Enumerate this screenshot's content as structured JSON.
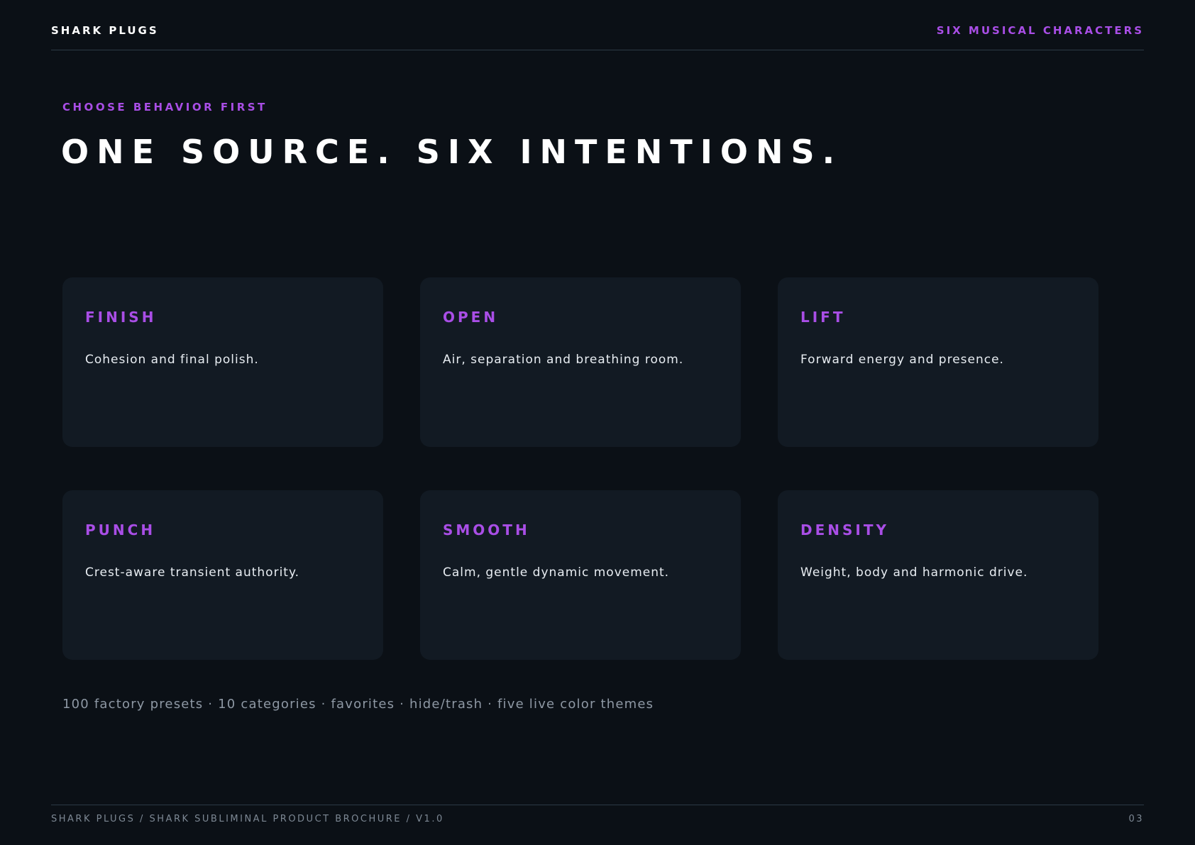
{
  "header": {
    "brand": "SHARK PLUGS",
    "tag": "SIX MUSICAL CHARACTERS"
  },
  "hero": {
    "eyebrow": "CHOOSE BEHAVIOR FIRST",
    "headline": "ONE SOURCE. SIX INTENTIONS."
  },
  "cards": [
    {
      "title": "FINISH",
      "description": "Cohesion and final polish."
    },
    {
      "title": "OPEN",
      "description": "Air, separation and breathing room."
    },
    {
      "title": "LIFT",
      "description": "Forward energy and presence."
    },
    {
      "title": "PUNCH",
      "description": "Crest-aware transient authority."
    },
    {
      "title": "SMOOTH",
      "description": "Calm, gentle dynamic movement."
    },
    {
      "title": "DENSITY",
      "description": "Weight, body and harmonic drive."
    }
  ],
  "summary": "100 factory presets · 10 categories · favorites · hide/trash · five live color themes",
  "footer": {
    "left": "SHARK PLUGS / SHARK SUBLIMINAL PRODUCT BROCHURE / V1.0",
    "page_number": "03"
  },
  "colors": {
    "background": "#0b1016",
    "card": "#121a23",
    "accent": "#a94ee6",
    "rule": "#2c3a46"
  }
}
